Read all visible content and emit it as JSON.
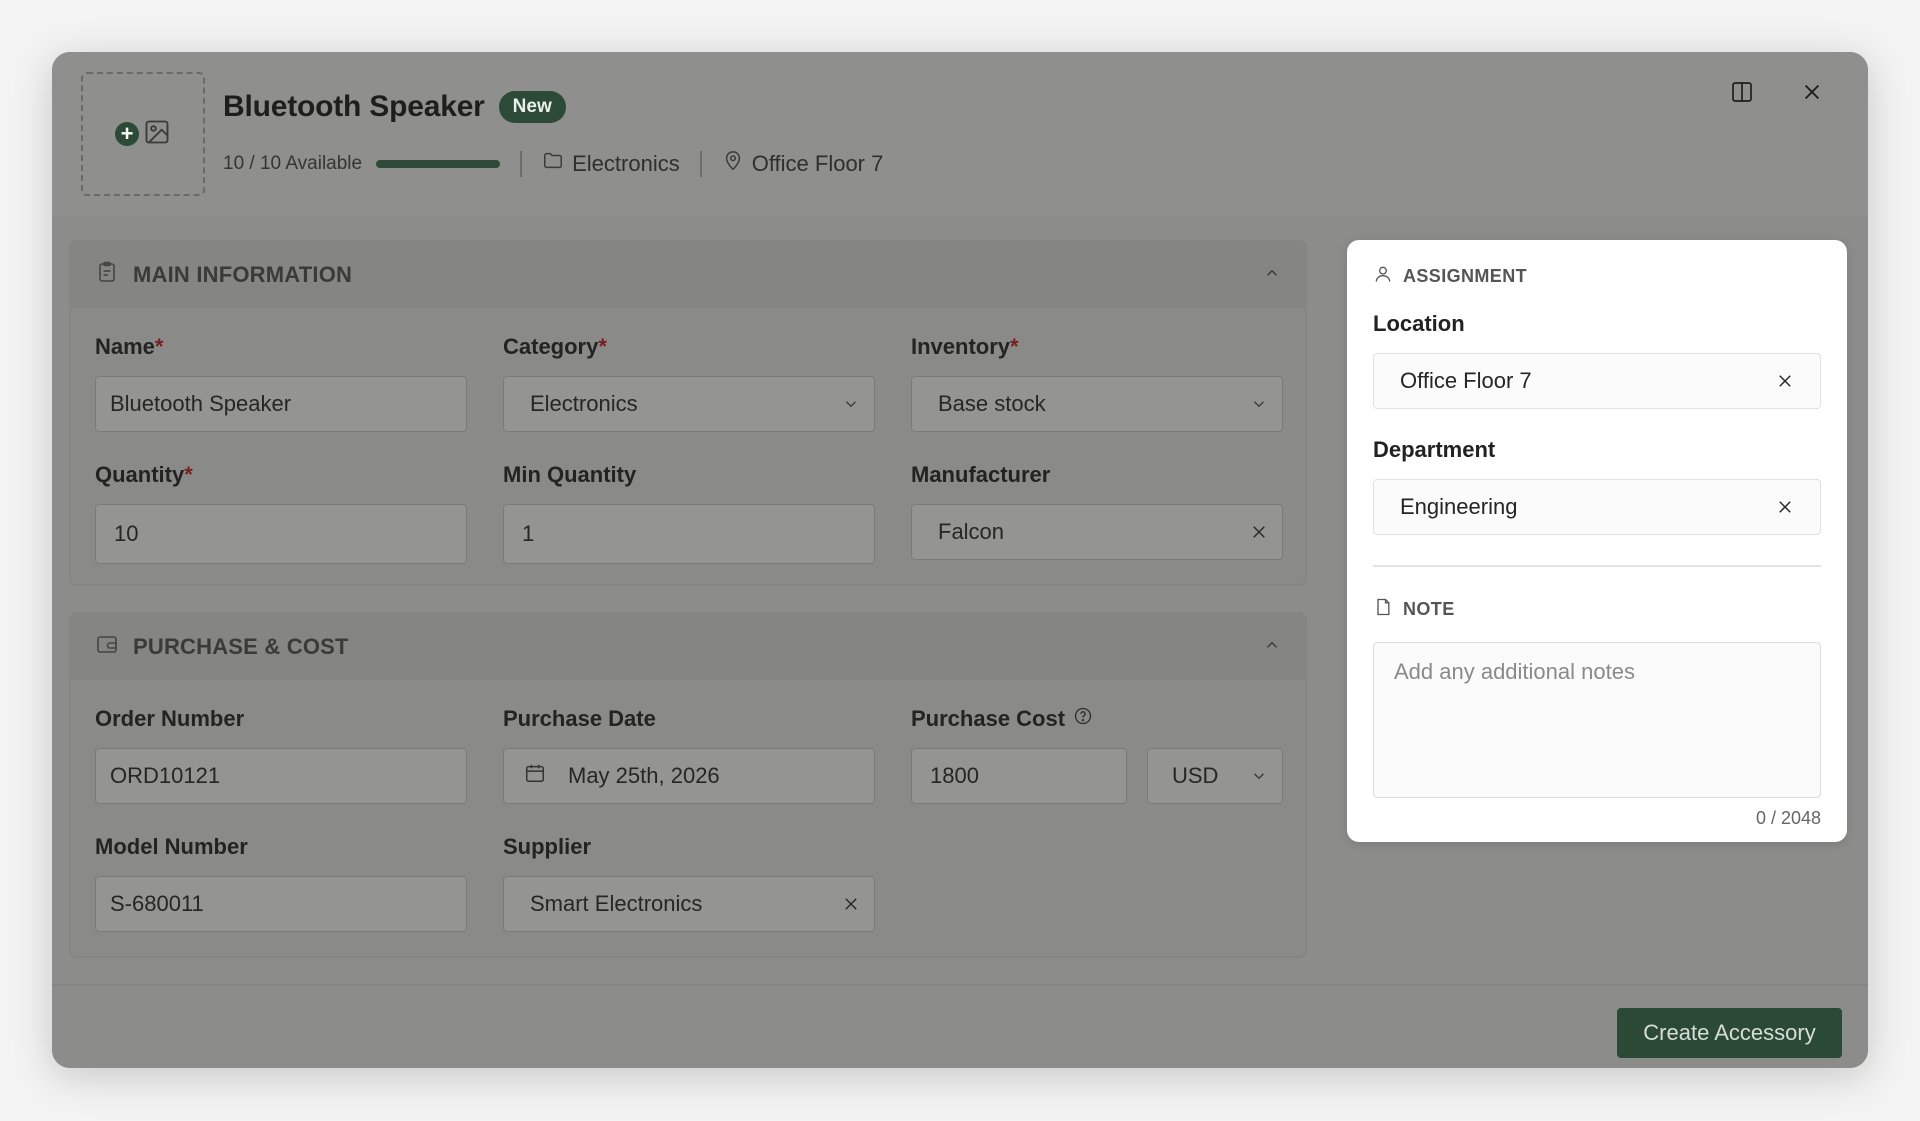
{
  "header": {
    "title": "Bluetooth Speaker",
    "badge": "New",
    "availability": "10 / 10 Available",
    "availability_fraction": 1.0,
    "category": "Electronics",
    "location": "Office Floor 7"
  },
  "main_info": {
    "title": "MAIN INFORMATION",
    "name_label": "Name",
    "name_value": "Bluetooth Speaker",
    "category_label": "Category",
    "category_value": "Electronics",
    "inventory_label": "Inventory",
    "inventory_value": "Base stock",
    "quantity_label": "Quantity",
    "quantity_value": "10",
    "min_quantity_label": "Min Quantity",
    "min_quantity_value": "1",
    "manufacturer_label": "Manufacturer",
    "manufacturer_value": "Falcon",
    "required_mark": "*"
  },
  "purchase": {
    "title": "PURCHASE & COST",
    "order_label": "Order Number",
    "order_value": "ORD10121",
    "date_label": "Purchase Date",
    "date_value": "May 25th, 2026",
    "cost_label": "Purchase Cost",
    "cost_value": "1800",
    "currency_value": "USD",
    "model_label": "Model Number",
    "model_value": "S-680011",
    "supplier_label": "Supplier",
    "supplier_value": "Smart Electronics"
  },
  "assignment": {
    "title": "ASSIGNMENT",
    "location_label": "Location",
    "location_value": "Office Floor 7",
    "department_label": "Department",
    "department_value": "Engineering"
  },
  "note": {
    "title": "NOTE",
    "placeholder": "Add any additional notes",
    "counter": "0 / 2048"
  },
  "footer": {
    "create_label": "Create Accessory"
  },
  "colors": {
    "brand_green": "#2c4a37",
    "overlay_gray": "#8c8c8b",
    "required_red": "#7a1f1f"
  }
}
